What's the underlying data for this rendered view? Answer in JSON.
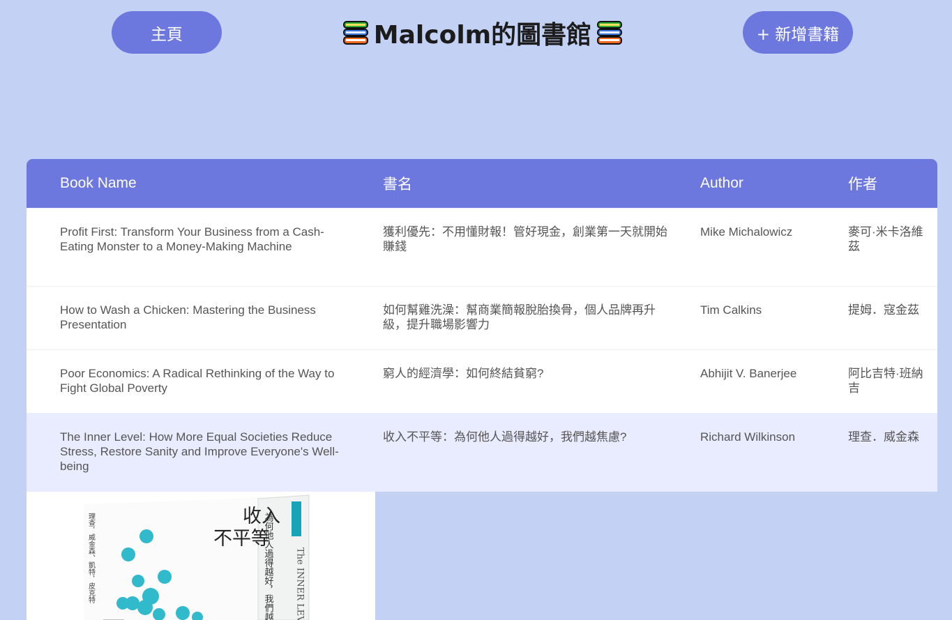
{
  "header": {
    "home_label": "主頁",
    "title": "Malcolm的圖書館",
    "add_label": "+ 新增書籍"
  },
  "table": {
    "columns": [
      "Book Name",
      "書名",
      "Author",
      "作者"
    ],
    "rows": [
      {
        "name": "Profit First: Transform Your Business from a Cash-Eating Monster to a Money-Making Machine",
        "title_zh": "獲利優先：不用懂財報！管好現金，創業第一天就開始賺錢",
        "author": "Mike Michalowicz",
        "author_zh": "麥可·米卡洛維茲"
      },
      {
        "name": "How to Wash a Chicken: Mastering the Business Presentation",
        "title_zh": "如何幫雞洗澡：幫商業簡報脫胎換骨，個人品牌再升級，提升職場影響力",
        "author": "Tim Calkins",
        "author_zh": "提姆．寇金茲"
      },
      {
        "name": "Poor Economics: A Radical Rethinking of the Way to Fight Global Poverty",
        "title_zh": "窮人的經濟學：如何終結貧窮?",
        "author": "Abhijit V. Banerjee",
        "author_zh": "阿比吉特·班納吉"
      },
      {
        "name": "The Inner Level: How More Equal Societies Reduce Stress, Restore Sanity and Improve Everyone's Well-being",
        "title_zh": "收入不平等：為何他人過得越好，我們越焦慮?",
        "author": "Richard Wilkinson",
        "author_zh": "理查．威金森"
      }
    ]
  },
  "cover": {
    "title_line1": "收入",
    "title_line2": "不平等",
    "spine_text": "為何他人過得越好，我們越焦慮?",
    "spine_en": "The INNER LEVEL",
    "author_text": "理查．威金森、凱特．皮克特",
    "colors": {
      "dots": "#1bb3c7",
      "box": "#ffffff"
    }
  },
  "colors": {
    "background": "#c3d1f4",
    "accent": "#6c78de",
    "active_row": "#e9ebfe"
  }
}
